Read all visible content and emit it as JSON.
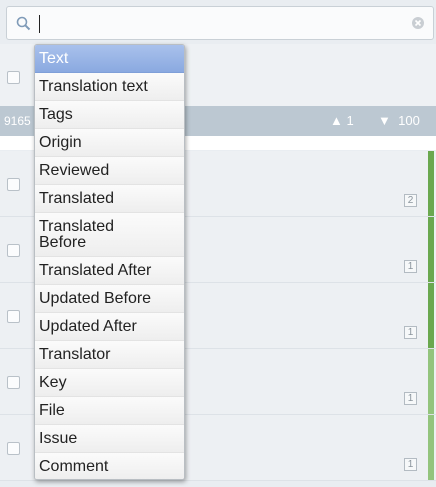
{
  "search": {
    "value": "",
    "placeholder": ""
  },
  "group_bar": {
    "id": "9165",
    "range_up": "1",
    "range_down": "100"
  },
  "rows": [
    {
      "count": "2",
      "stripe": "#6aa84f"
    },
    {
      "count": "1",
      "stripe": "#6aa84f"
    },
    {
      "count": "1",
      "stripe": "#6aa84f"
    },
    {
      "count": "1",
      "stripe": "#93c47d"
    },
    {
      "count": "1",
      "stripe": "#93c47d"
    }
  ],
  "menu": {
    "selected_index": 0,
    "items": [
      "Text",
      "Translation text",
      "Tags",
      "Origin",
      "Reviewed",
      "Translated",
      "Translated Before",
      "Translated After",
      "Updated Before",
      "Updated After",
      "Translator",
      "Key",
      "File",
      "Issue",
      "Comment"
    ]
  },
  "colors": {
    "accent": "#8aa9e0",
    "group_bar": "#bcc8d2"
  },
  "icons": {
    "search": "search-icon",
    "clear": "clear-icon"
  }
}
